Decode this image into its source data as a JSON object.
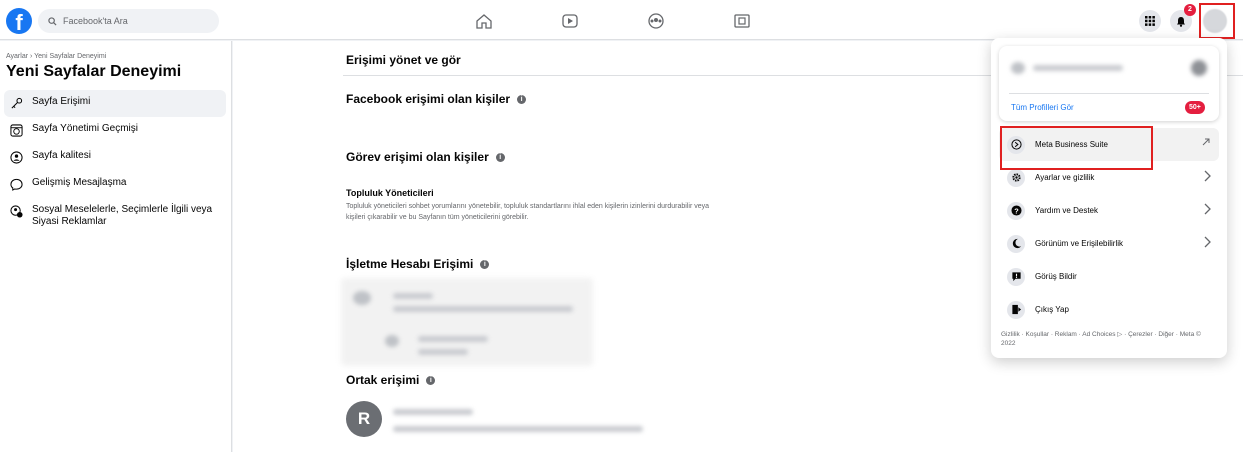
{
  "search": {
    "placeholder": "Facebook'ta Ara"
  },
  "notifications": {
    "count": "2"
  },
  "sidebar": {
    "breadcrumb": "Ayarlar › Yeni Sayfalar Deneyimi",
    "title": "Yeni Sayfalar Deneyimi",
    "items": [
      {
        "label": "Sayfa Erişimi",
        "icon": "key-icon"
      },
      {
        "label": "Sayfa Yönetimi Geçmişi",
        "icon": "history-icon"
      },
      {
        "label": "Sayfa kalitesi",
        "icon": "quality-icon"
      },
      {
        "label": "Gelişmiş Mesajlaşma",
        "icon": "message-icon"
      },
      {
        "label": "Sosyal Meselelerle, Seçimlerle İlgili veya Siyasi Reklamlar",
        "icon": "political-ads-icon"
      }
    ]
  },
  "main": {
    "manage_title": "Erişimi yönet ve gör",
    "fb_access_title": "Facebook erişimi olan kişiler",
    "task_access_title": "Görev erişimi olan kişiler",
    "community_title": "Topluluk Yöneticileri",
    "community_desc": "Topluluk yöneticileri sohbet yorumlarını yönetebilir, topluluk standartlarını ihlal eden kişilerin izinlerini durdurabilir veya kişileri çıkarabilir ve bu Sayfanın tüm yöneticilerini görebilir.",
    "business_access_title": "İşletme Hesabı Erişimi",
    "shared_access_title": "Ortak erişimi",
    "shared_avatar_letter": "R"
  },
  "dropdown": {
    "all_profiles": "Tüm Profilleri Gör",
    "profiles_badge": "50+",
    "menu": [
      {
        "label": "Meta Business Suite",
        "icon": "meta-business-icon"
      },
      {
        "label": "Ayarlar ve gizlilik",
        "icon": "gear-icon"
      },
      {
        "label": "Yardım ve Destek",
        "icon": "help-icon"
      },
      {
        "label": "Görünüm ve Erişilebilirlik",
        "icon": "moon-icon"
      },
      {
        "label": "Görüş Bildir",
        "icon": "feedback-icon"
      },
      {
        "label": "Çıkış Yap",
        "icon": "logout-icon"
      }
    ],
    "footer": "Gizlilik · Koşullar · Reklam · Ad Choices ▷ · Çerezler · Diğer · Meta © 2022"
  },
  "colors": {
    "brand": "#1877f2",
    "highlight": "#e02020",
    "badge": "#e41e3f"
  }
}
